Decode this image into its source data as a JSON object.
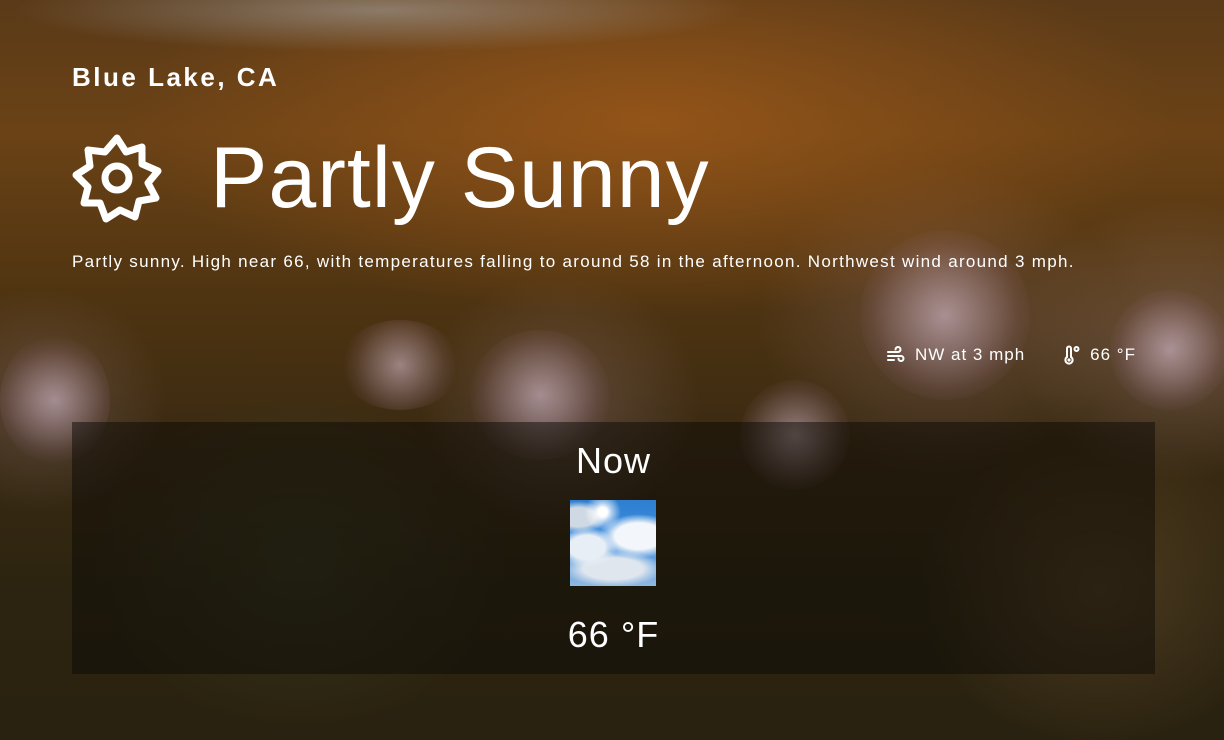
{
  "location": "Blue Lake, CA",
  "condition": {
    "title": "Partly Sunny",
    "icon": "sun-icon",
    "description": "Partly sunny. High near 66, with temperatures falling to around 58 in the afternoon. Northwest wind around 3 mph."
  },
  "stats": {
    "wind": {
      "icon": "wind-icon",
      "text": "NW at 3 mph"
    },
    "temperature": {
      "icon": "thermometer-icon",
      "text": "66 °F"
    }
  },
  "now": {
    "label": "Now",
    "image": "partly-sunny-sky-image",
    "temperature": "66 °F"
  }
}
